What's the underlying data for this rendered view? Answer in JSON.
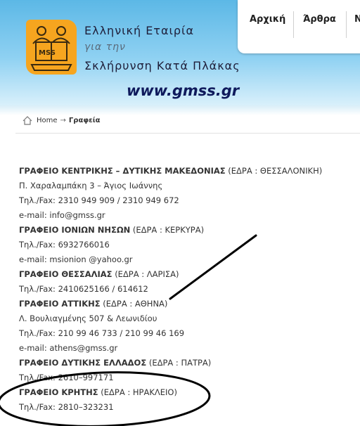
{
  "header": {
    "brand_line1": "Ελληνική Εταιρία",
    "brand_line2": "για την",
    "brand_line3": "Σκλήρυνση Κατά Πλάκας",
    "site_url": "www.gmss.gr",
    "logo_text": "MSS"
  },
  "nav": {
    "items": [
      {
        "label": "Αρχική"
      },
      {
        "label": "Άρθρα"
      },
      {
        "label": "N"
      }
    ]
  },
  "breadcrumb": {
    "home": "Home",
    "separator": "→",
    "current": "Γραφεία"
  },
  "offices": [
    {
      "name": "ΓΡΑΦΕΙΟ ΚΕΝΤΡΙΚΗΣ – ΔΥΤΙΚΗΣ ΜΑΚΕΔΟΝΙΑΣ",
      "seat": "(ΕΔΡΑ : ΘΕΣΣΑΛΟΝΙΚΗ)",
      "address": "Π. Χαραλαμπάκη 3 – Άγιος Ιωάννης",
      "phone": "Τηλ./Fax: 2310 949 909 / 2310 949 672",
      "email": "e-mail: info@gmss.gr"
    },
    {
      "name": "ΓΡΑΦΕΙΟ ΙΟΝΙΩΝ ΝΗΣΩΝ",
      "seat": "(ΕΔΡΑ : ΚΕΡΚΥΡΑ)",
      "phone": "Τηλ./Fax: 6932766016",
      "email": "e-mail: msionion @yahoo.gr"
    },
    {
      "name": "ΓΡΑΦΕΙΟ ΘΕΣΣΑΛΙΑΣ",
      "seat": "(ΕΔΡΑ : ΛΑΡΙΣΑ)",
      "phone": "Τηλ./Fax: 2410625166 / 614612"
    },
    {
      "name": "ΓΡΑΦΕΙΟ ΑΤΤΙΚΗΣ",
      "seat": "(ΕΔΡΑ : ΑΘΗΝΑ)",
      "address": "Λ. Βουλιαγμένης 507 & Λεωνιδίου",
      "phone": "Τηλ./Fax: 210 99 46 733 / 210 99 46 169",
      "email": "e-mail: athens@gmss.gr"
    },
    {
      "name": "ΓΡΑΦΕΙΟ ΔΥΤΙΚΗΣ ΕΛΛΑΔΟΣ",
      "seat": "(ΕΔΡΑ : ΠΑΤΡΑ)",
      "phone": "Τηλ./Fax: 2610–997171"
    },
    {
      "name": "ΓΡΑΦΕΙΟ ΚΡΗΤΗΣ",
      "seat": "(ΕΔΡΑ : ΗΡΑΚΛΕΙΟ)",
      "phone": "Τηλ./Fax: 2810–323231"
    }
  ],
  "annotation_color": "#000000"
}
